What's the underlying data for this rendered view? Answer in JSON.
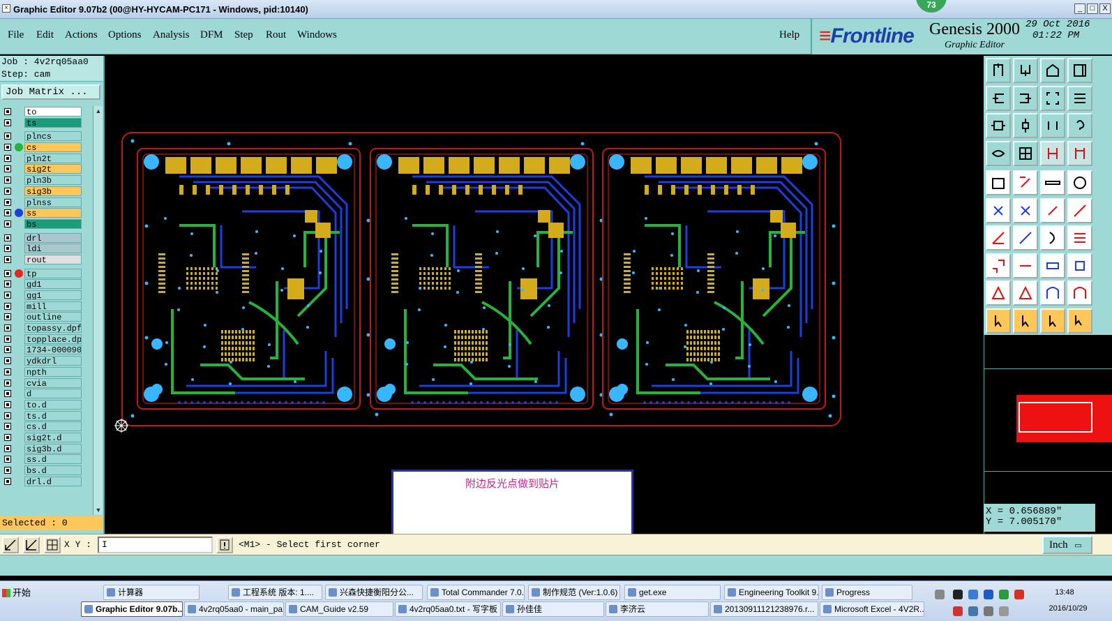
{
  "window": {
    "title": "Graphic Editor 9.07b2 (00@HY-HYCAM-PC171 - Windows, pid:10140)",
    "badge": "73",
    "min": "_",
    "max": "□",
    "close": "X"
  },
  "menu": {
    "items": [
      "File",
      "Edit",
      "Actions",
      "Options",
      "Analysis",
      "DFM",
      "Step",
      "Rout",
      "Windows"
    ],
    "help": "Help"
  },
  "logo": {
    "brand": "Frontline",
    "product": "Genesis 2000",
    "subtitle": "Graphic Editor",
    "date": "29 Oct 2016",
    "time": "01:22 PM"
  },
  "job": {
    "job_line": "Job : 4v2rq05aa0",
    "step_line": "Step: cam",
    "matrix_button": "Job Matrix ..."
  },
  "layers": [
    {
      "name": "to",
      "bg": "#ffffff",
      "dot": ""
    },
    {
      "name": "ts",
      "bg": "#1a9c7a",
      "dot": ""
    },
    {
      "name": "plncs",
      "bg": "#9ed9d6",
      "dot": ""
    },
    {
      "name": "cs",
      "bg": "#ffc65a",
      "dot": "#27b23a"
    },
    {
      "name": "pln2t",
      "bg": "#9ed9d6",
      "dot": ""
    },
    {
      "name": "sig2t",
      "bg": "#ffc65a",
      "dot": ""
    },
    {
      "name": "pln3b",
      "bg": "#9ed9d6",
      "dot": ""
    },
    {
      "name": "sig3b",
      "bg": "#ffc65a",
      "dot": ""
    },
    {
      "name": "plnss",
      "bg": "#9ed9d6",
      "dot": ""
    },
    {
      "name": "ss",
      "bg": "#ffc65a",
      "dot": "#1c3ee0"
    },
    {
      "name": "bs",
      "bg": "#1a9c7a",
      "dot": ""
    },
    {
      "name": "drl",
      "bg": "#a9c7cf",
      "dot": ""
    },
    {
      "name": "ldi",
      "bg": "#a9c7cf",
      "dot": ""
    },
    {
      "name": "rout",
      "bg": "#e0e0e0",
      "dot": ""
    },
    {
      "name": "tp",
      "bg": "#9ed9d6",
      "dot": "#e8261c"
    },
    {
      "name": "gd1",
      "bg": "#9ed9d6",
      "dot": ""
    },
    {
      "name": "gg1",
      "bg": "#9ed9d6",
      "dot": ""
    },
    {
      "name": "mill",
      "bg": "#9ed9d6",
      "dot": ""
    },
    {
      "name": "outline",
      "bg": "#9ed9d6",
      "dot": ""
    },
    {
      "name": "topassy.dpf",
      "bg": "#9ed9d6",
      "dot": ""
    },
    {
      "name": "topplace.dp",
      "bg": "#9ed9d6",
      "dot": ""
    },
    {
      "name": "1734-000090",
      "bg": "#9ed9d6",
      "dot": ""
    },
    {
      "name": "ydkdrl",
      "bg": "#9ed9d6",
      "dot": ""
    },
    {
      "name": "npth",
      "bg": "#9ed9d6",
      "dot": ""
    },
    {
      "name": "cvia",
      "bg": "#9ed9d6",
      "dot": ""
    },
    {
      "name": "d",
      "bg": "#9ed9d6",
      "dot": ""
    },
    {
      "name": "to.d",
      "bg": "#9ed9d6",
      "dot": ""
    },
    {
      "name": "ts.d",
      "bg": "#9ed9d6",
      "dot": ""
    },
    {
      "name": "cs.d",
      "bg": "#9ed9d6",
      "dot": ""
    },
    {
      "name": "sig2t.d",
      "bg": "#9ed9d6",
      "dot": ""
    },
    {
      "name": "sig3b.d",
      "bg": "#9ed9d6",
      "dot": ""
    },
    {
      "name": "ss.d",
      "bg": "#9ed9d6",
      "dot": ""
    },
    {
      "name": "bs.d",
      "bg": "#9ed9d6",
      "dot": ""
    },
    {
      "name": "drl.d",
      "bg": "#9ed9d6",
      "dot": ""
    }
  ],
  "status": {
    "selected": "Selected : 0",
    "xy_label": "X Y :",
    "xy_value": "I",
    "prompt": "<M1> - Select first corner",
    "unit": "Inch",
    "coord_x": "X = 0.656889\"",
    "coord_y": "Y = 7.005170\""
  },
  "note": {
    "text": "附边反光点做到贴片"
  },
  "taskbar": {
    "start": "开始",
    "row1": [
      "计算器",
      "工程系统 版本: 1....",
      "兴森快捷衡阳分公...",
      "Total Commander 7.0...",
      "制作规范 (Ver:1.0.6)",
      "get.exe",
      "Engineering Toolkit 9....",
      "Progress"
    ],
    "row2": [
      "Graphic Editor 9.07b...",
      "4v2rq05aa0 - main_pa...",
      "CAM_Guide v2.59",
      "4v2rq05aa0.txt - 写字板",
      "孙佳佳",
      "李济云",
      "20130911121238976.r...",
      "Microsoft Excel - 4V2R..."
    ],
    "clock": "13:48",
    "date": "2016/10/29"
  },
  "colors": {
    "panel": "#9ed9d6",
    "copper_top": "#27b23a",
    "copper_inner": "#1c3ee0",
    "pad": "#d4ac1b",
    "outline": "#c01818",
    "hole": "#38b6ff"
  }
}
